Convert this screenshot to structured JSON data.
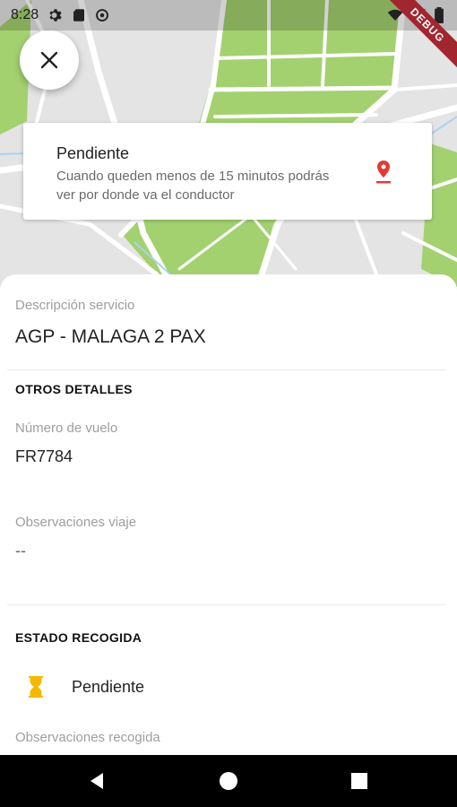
{
  "status_bar": {
    "time": "8:28",
    "left_icons": [
      "gear-icon",
      "sd-card-icon",
      "sync-icon"
    ],
    "right_icons": [
      "wifi-icon",
      "signal-icon",
      "battery-icon"
    ],
    "debug_banner": "DEBUG"
  },
  "map": {
    "green": "#a3d16f",
    "road": "#ffffff",
    "base": "#e6e6e6",
    "water": "#a8d3f0"
  },
  "close_button": {
    "icon": "close-icon"
  },
  "info_card": {
    "title": "Pendiente",
    "subtitle": "Cuando queden menos de 15 minutos podrás ver por donde va el conductor",
    "icon": "location-pin-icon",
    "icon_color": "#e53935"
  },
  "sheet": {
    "service_label": "Descripción servicio",
    "service_value": "AGP - MALAGA 2 PAX",
    "other_details_title": "OTROS DETALLES",
    "flight_label": "Número de vuelo",
    "flight_value": "FR7784",
    "trip_notes_label": "Observaciones viaje",
    "trip_notes_value": "--",
    "pickup_title": "ESTADO RECOGIDA",
    "pickup_status": "Pendiente",
    "pickup_icon": "hourglass-icon",
    "pickup_icon_color": "#f5b800",
    "pickup_notes_label": "Observaciones recogida"
  },
  "nav_bar": {
    "icons": [
      "back-icon",
      "home-icon",
      "recents-icon"
    ]
  }
}
